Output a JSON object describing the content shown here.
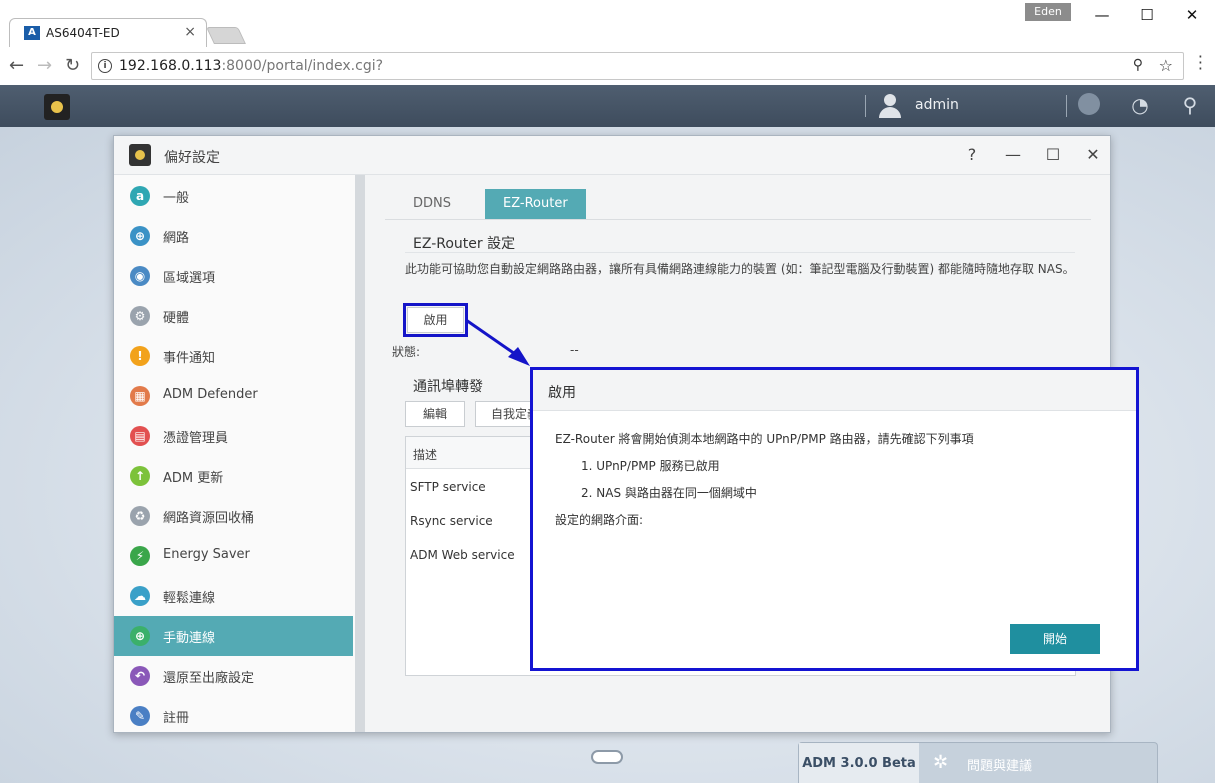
{
  "browser": {
    "tab_title": "AS6404T-ED",
    "tab_close": "×",
    "profile": "Eden",
    "url_host": "192.168.0.113",
    "url_path": ":8000/portal/index.cgi?",
    "win_min": "—",
    "win_max": "☐",
    "win_close": "✕"
  },
  "taskbar": {
    "username": "admin"
  },
  "window": {
    "title": "偏好設定",
    "help": "?",
    "minimize": "—",
    "maximize": "☐",
    "close": "✕"
  },
  "sidebar": {
    "items": [
      {
        "label": "一般",
        "icon": "at-icon",
        "color": "#2fa7b3",
        "glyph": "a"
      },
      {
        "label": "網路",
        "icon": "globe-icon",
        "color": "#3a92c6",
        "glyph": "⊕"
      },
      {
        "label": "區域選項",
        "icon": "region-icon",
        "color": "#4a8ac4",
        "glyph": "◉"
      },
      {
        "label": "硬體",
        "icon": "hardware-icon",
        "color": "#9aa3ad",
        "glyph": "⚙"
      },
      {
        "label": "事件通知",
        "icon": "alert-icon",
        "color": "#f2a21b",
        "glyph": "!"
      },
      {
        "label": "ADM Defender",
        "icon": "firewall-icon",
        "color": "#e27a4a",
        "glyph": "▦"
      },
      {
        "label": "憑證管理員",
        "icon": "certificate-icon",
        "color": "#e25050",
        "glyph": "▤"
      },
      {
        "label": "ADM 更新",
        "icon": "update-arrow-icon",
        "color": "#7cc23a",
        "glyph": "↑"
      },
      {
        "label": "網路資源回收桶",
        "icon": "recycle-bin-icon",
        "color": "#9aa3ad",
        "glyph": "♻"
      },
      {
        "label": "Energy Saver",
        "icon": "energy-icon",
        "color": "#3aa64a",
        "glyph": "⚡"
      },
      {
        "label": "輕鬆連線",
        "icon": "cloud-icon",
        "color": "#3aa0c8",
        "glyph": "☁"
      },
      {
        "label": "手動連線",
        "icon": "manual-connect-icon",
        "color": "#3bb06a",
        "glyph": "⊕"
      },
      {
        "label": "還原至出廠設定",
        "icon": "restore-icon",
        "color": "#8a58b8",
        "glyph": "↶"
      },
      {
        "label": "註冊",
        "icon": "register-icon",
        "color": "#4a7fc4",
        "glyph": "✎"
      }
    ],
    "active_index": 11
  },
  "content": {
    "tabs": [
      {
        "label": "DDNS",
        "active": false
      },
      {
        "label": "EZ-Router",
        "active": true
      }
    ],
    "section_title": "EZ-Router 設定",
    "description": "此功能可協助您自動設定網路路由器，讓所有具備網路連線能力的裝置 (如：筆記型電腦及行動裝置) 都能隨時隨地存取 NAS。",
    "enable_button": "啟用",
    "status_label": "狀態:",
    "status_value": "--",
    "port_section_title": "通訊埠轉發",
    "edit_button": "編輯",
    "custom_button": "自我定義",
    "table_header": "描述",
    "rows": [
      "SFTP service",
      "Rsync service",
      "ADM Web service"
    ]
  },
  "modal": {
    "title": "啟用",
    "intro": "EZ-Router 將會開始偵測本地網路中的 UPnP/PMP 路由器，請先確認下列事項",
    "item1": "1. UPnP/PMP 服務已啟用",
    "item2": "2. NAS 與路由器在同一個網域中",
    "iface_label": "設定的網路介面:",
    "start_button": "開始"
  },
  "footer": {
    "version": "ADM 3.0.0 Beta",
    "feedback": "問題與建議"
  },
  "colors": {
    "accent": "#54aab4",
    "annotation": "#1414c8",
    "start_button": "#1f8f9f"
  }
}
